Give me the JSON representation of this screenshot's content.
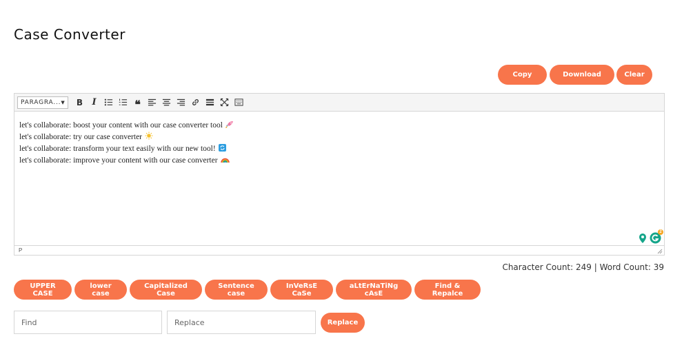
{
  "page": {
    "title": "Case Converter"
  },
  "actions": {
    "copy": "Copy",
    "download": "Download",
    "clear": "Clear"
  },
  "toolbar": {
    "format": "PARAGRA..."
  },
  "editor": {
    "lines": [
      {
        "text": "let's collaborate: boost your content with our case converter tool",
        "emoji": "rocket-icon"
      },
      {
        "text": "let's collaborate: try our case converter",
        "emoji": "sun-icon"
      },
      {
        "text": "let's collaborate: transform your text easily with our new tool!",
        "emoji": "repeat-icon"
      },
      {
        "text": "let's collaborate: improve your content with our case converter",
        "emoji": "rainbow-icon"
      }
    ],
    "status_path": "P",
    "grammarly_badge": "2"
  },
  "counts": {
    "text": "Character Count: 249 | Word Count: 39"
  },
  "cases": {
    "upper": "UPPER CASE",
    "lower": "lower case",
    "capitalized": "Capitalized Case",
    "sentence": "Sentence case",
    "inverse": "InVeRsE CaSe",
    "alternating": "aLtErNaTiNg cAsE",
    "find_replace": "Find & Repalce"
  },
  "find_replace": {
    "find_placeholder": "Find",
    "replace_placeholder": "Replace",
    "replace_button": "Replace"
  },
  "colors": {
    "accent": "#f8754b",
    "border": "#d6d6d6",
    "toolbar_bg": "#f5f5f5"
  }
}
